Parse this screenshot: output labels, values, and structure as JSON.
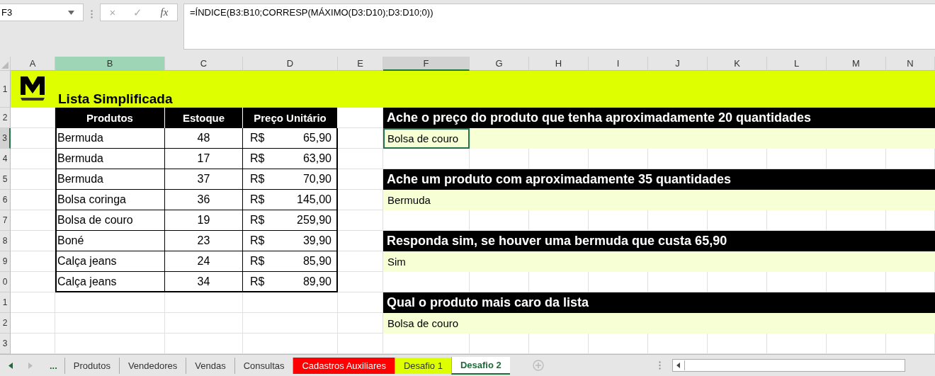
{
  "name_box": "F3",
  "formula_buttons": [
    "×",
    "✓",
    "fx"
  ],
  "formula": "=ÍNDICE(B3:B10;CORRESP(MÁXIMO(D3:D10);D3:D10;0))",
  "columns": [
    {
      "label": "A",
      "highlighted": false,
      "selected": false
    },
    {
      "label": "B",
      "highlighted": true,
      "selected": false
    },
    {
      "label": "C",
      "highlighted": false,
      "selected": false
    },
    {
      "label": "D",
      "highlighted": false,
      "selected": false
    },
    {
      "label": "E",
      "highlighted": false,
      "selected": false
    },
    {
      "label": "F",
      "highlighted": false,
      "selected": true
    },
    {
      "label": "G",
      "highlighted": false,
      "selected": false
    },
    {
      "label": "H",
      "highlighted": false,
      "selected": false
    },
    {
      "label": "I",
      "highlighted": false,
      "selected": false
    },
    {
      "label": "J",
      "highlighted": false,
      "selected": false
    },
    {
      "label": "K",
      "highlighted": false,
      "selected": false
    },
    {
      "label": "L",
      "highlighted": false,
      "selected": false
    },
    {
      "label": "M",
      "highlighted": false,
      "selected": false
    },
    {
      "label": "N",
      "highlighted": false,
      "selected": false
    }
  ],
  "rows": [
    {
      "label": "1",
      "selected": false
    },
    {
      "label": "2",
      "selected": false
    },
    {
      "label": "3",
      "selected": true
    },
    {
      "label": "4",
      "selected": false
    },
    {
      "label": "5",
      "selected": false
    },
    {
      "label": "6",
      "selected": false
    },
    {
      "label": "7",
      "selected": false
    },
    {
      "label": "8",
      "selected": false
    },
    {
      "label": "9",
      "selected": false
    },
    {
      "label": "0",
      "selected": false
    },
    {
      "label": "1",
      "selected": false
    },
    {
      "label": "2",
      "selected": false
    },
    {
      "label": "3",
      "selected": false
    }
  ],
  "title": "Lista Simplificada",
  "table": {
    "columns": [
      "Produtos",
      "Estoque",
      "Preço Unitário"
    ],
    "rows": [
      {
        "produto": "Bermuda",
        "estoque": "48",
        "moeda": "R$",
        "preco": "65,90"
      },
      {
        "produto": "Bermuda",
        "estoque": "17",
        "moeda": "R$",
        "preco": "63,90"
      },
      {
        "produto": "Bermuda",
        "estoque": "37",
        "moeda": "R$",
        "preco": "70,90"
      },
      {
        "produto": "Bolsa coringa",
        "estoque": "36",
        "moeda": "R$",
        "preco": "145,00"
      },
      {
        "produto": "Bolsa de couro",
        "estoque": "19",
        "moeda": "R$",
        "preco": "259,90"
      },
      {
        "produto": "Boné",
        "estoque": "23",
        "moeda": "R$",
        "preco": "39,90"
      },
      {
        "produto": "Calça jeans",
        "estoque": "24",
        "moeda": "R$",
        "preco": "85,90"
      },
      {
        "produto": "Calça jeans",
        "estoque": "34",
        "moeda": "R$",
        "preco": "89,90"
      }
    ]
  },
  "questions": [
    {
      "question": "Ache o preço do produto que tenha aproximadamente 20 quantidades",
      "answer": "Bolsa de couro",
      "selected": true
    },
    {
      "question": "Ache um produto com aproximadamente 35 quantidades",
      "answer": "Bermuda",
      "selected": false
    },
    {
      "question": "Responda sim, se houver uma bermuda que custa 65,90",
      "answer": "Sim",
      "selected": false
    },
    {
      "question": "Qual o produto mais caro da lista",
      "answer": "Bolsa de couro",
      "selected": false
    }
  ],
  "sheet_more": "...",
  "sheet_tabs": [
    {
      "label": "Produtos",
      "selected": false
    },
    {
      "label": "Vendedores",
      "selected": false
    },
    {
      "label": "Vendas",
      "selected": false
    },
    {
      "label": "Consultas",
      "selected": false
    },
    {
      "label": "Cadastros Auxiliares",
      "selected": false,
      "color": "#ff0000"
    },
    {
      "label": "Desafio 1",
      "selected": false,
      "color": "#ddff00"
    },
    {
      "label": "Desafio 2",
      "selected": true
    }
  ]
}
